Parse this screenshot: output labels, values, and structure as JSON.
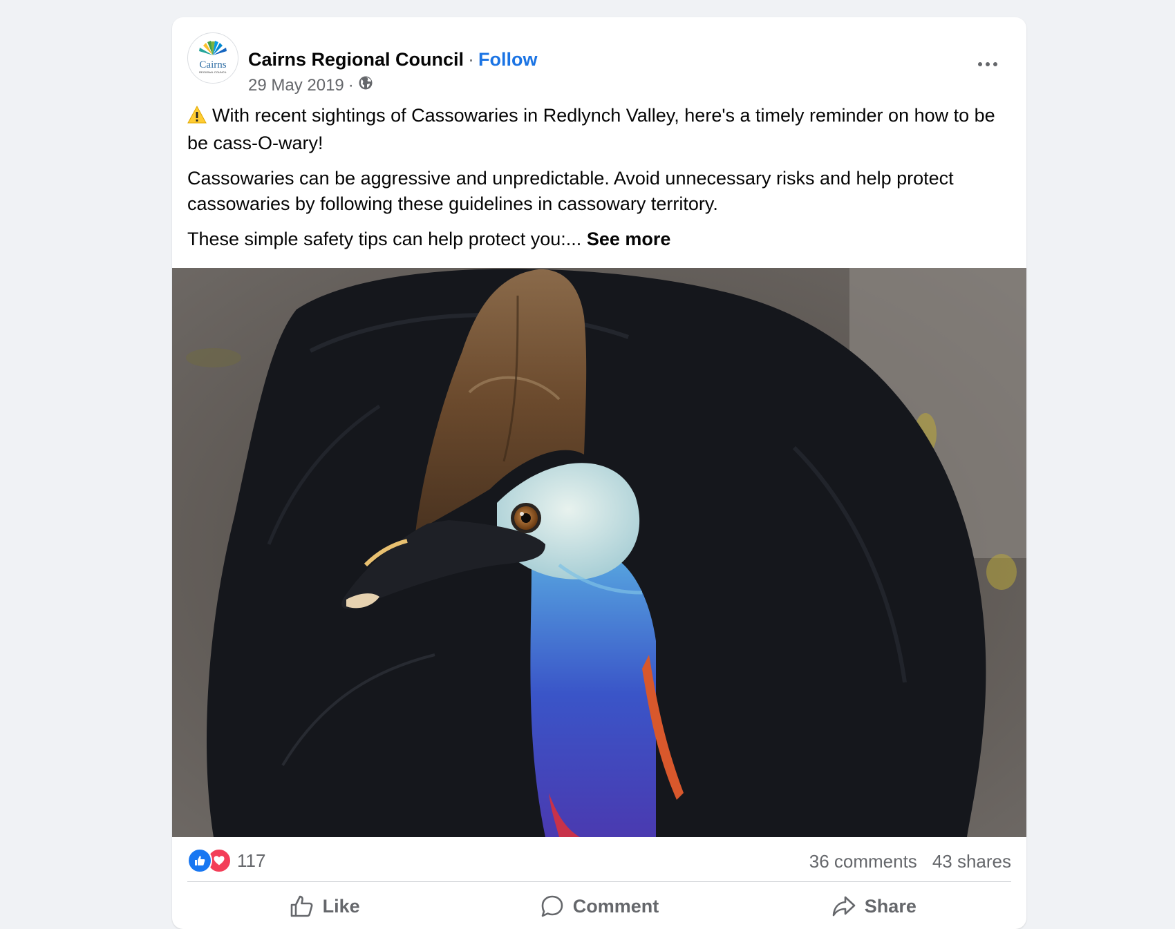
{
  "post": {
    "page_name": "Cairns Regional Council",
    "separator": "·",
    "follow_label": "Follow",
    "date": "29 May 2019",
    "meta_separator": "·",
    "avatar_logo_text": "Cairns",
    "avatar_logo_subtext": "REGIONAL COUNCIL",
    "audience_icon": "globe-icon",
    "more_icon": "ellipsis-icon",
    "paragraphs": [
      "With recent sightings of Cassowaries in Redlynch Valley, here's a timely reminder on how to be be cass-O-wary!",
      "Cassowaries can be aggressive and unpredictable. Avoid unnecessary risks and help protect cassowaries by following these guidelines in cassowary territory.",
      "These simple safety tips can help protect you:..."
    ],
    "warning_icon": "warning-icon",
    "see_more_label": "See more"
  },
  "stats": {
    "reaction_icons": [
      "like-reaction-icon",
      "love-reaction-icon"
    ],
    "reaction_count": "117",
    "comments": "36 comments",
    "shares": "43 shares"
  },
  "actions": {
    "like_label": "Like",
    "comment_label": "Comment",
    "share_label": "Share"
  },
  "colors": {
    "accent": "#1b74e4",
    "secondary_text": "#65676b",
    "like_blue": "#1877f2",
    "love_red": "#f33e58"
  }
}
